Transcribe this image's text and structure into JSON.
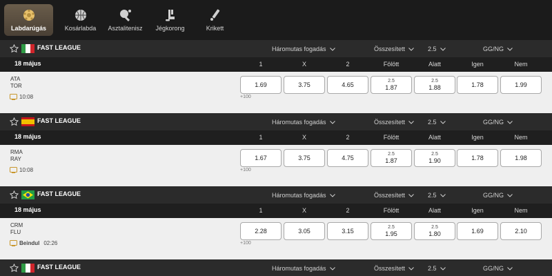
{
  "sports": [
    {
      "label": "Labdarúgás",
      "icon": "soccer-ball-icon",
      "active": true
    },
    {
      "label": "Kosárlabda",
      "icon": "basketball-icon",
      "active": false
    },
    {
      "label": "Asztalitenisz",
      "icon": "table-tennis-icon",
      "active": false
    },
    {
      "label": "Jégkorong",
      "icon": "ice-hockey-icon",
      "active": false
    },
    {
      "label": "Krikett",
      "icon": "cricket-icon",
      "active": false
    }
  ],
  "markets": {
    "three_way": "Háromutas fogadás",
    "total": "Összesített",
    "line": "2.5",
    "btts": "GG/NG"
  },
  "columns": [
    "1",
    "X",
    "2",
    "Fölött",
    "Alatt",
    "Igen",
    "Nem"
  ],
  "colors": {
    "accent": "#5e5242",
    "header_bg": "#2b2b2b",
    "row_bg": "#efefef"
  },
  "leagues": [
    {
      "name": "FAST LEAGUE",
      "flag": "italy",
      "date": "18 május",
      "match": {
        "home": "ATA",
        "away": "TOR",
        "time": "10:08",
        "live": "",
        "more": "+100",
        "odds": [
          {
            "line": "",
            "value": "1.69"
          },
          {
            "line": "",
            "value": "3.75"
          },
          {
            "line": "",
            "value": "4.65"
          },
          {
            "line": "2.5",
            "value": "1.87"
          },
          {
            "line": "2.5",
            "value": "1.88"
          },
          {
            "line": "",
            "value": "1.78"
          },
          {
            "line": "",
            "value": "1.99"
          }
        ]
      }
    },
    {
      "name": "FAST LEAGUE",
      "flag": "spain",
      "date": "18 május",
      "match": {
        "home": "RMA",
        "away": "RAY",
        "time": "10:08",
        "live": "",
        "more": "+100",
        "odds": [
          {
            "line": "",
            "value": "1.67"
          },
          {
            "line": "",
            "value": "3.75"
          },
          {
            "line": "",
            "value": "4.75"
          },
          {
            "line": "2.5",
            "value": "1.87"
          },
          {
            "line": "2.5",
            "value": "1.90"
          },
          {
            "line": "",
            "value": "1.78"
          },
          {
            "line": "",
            "value": "1.98"
          }
        ]
      }
    },
    {
      "name": "FAST LEAGUE",
      "flag": "brazil",
      "date": "18 május",
      "match": {
        "home": "CRM",
        "away": "FLU",
        "time": "02:26",
        "live": "Beindul",
        "more": "+100",
        "odds": [
          {
            "line": "",
            "value": "2.28"
          },
          {
            "line": "",
            "value": "3.05"
          },
          {
            "line": "",
            "value": "3.15"
          },
          {
            "line": "2.5",
            "value": "1.95"
          },
          {
            "line": "2.5",
            "value": "1.80"
          },
          {
            "line": "",
            "value": "1.69"
          },
          {
            "line": "",
            "value": "2.10"
          }
        ]
      }
    },
    {
      "name": "FAST LEAGUE",
      "flag": "italy"
    }
  ]
}
